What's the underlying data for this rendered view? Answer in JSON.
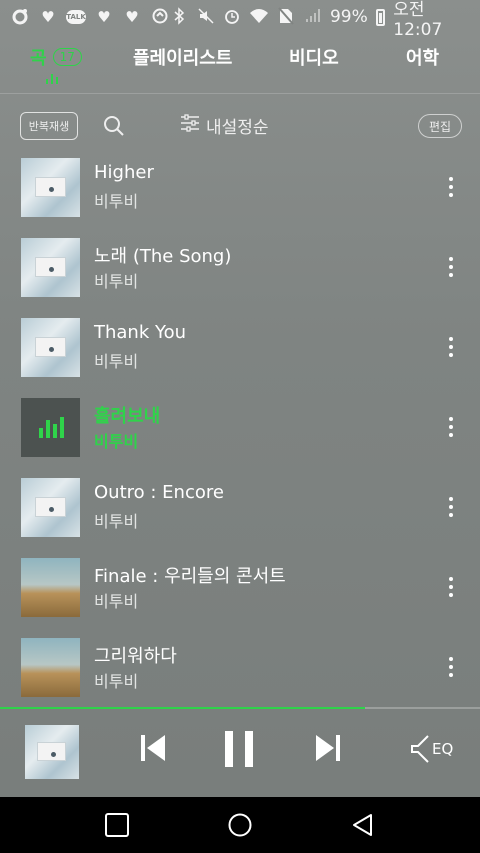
{
  "status_bar": {
    "left_icons": [
      "loop-icon",
      "heart-icon",
      "talk-icon",
      "heart-icon",
      "heart-icon",
      "sync-icon"
    ],
    "talk_label": "TALK",
    "battery": "99%",
    "time": "오전 12:07"
  },
  "tabs": {
    "songs": {
      "label": "곡",
      "count": "17"
    },
    "playlists": {
      "label": "플레이리스트"
    },
    "videos": {
      "label": "비디오"
    },
    "language": {
      "label": "어학"
    }
  },
  "toolbar": {
    "repeat_label": "반복재생",
    "sort_label": "내설정순",
    "edit_label": "편집"
  },
  "songs": [
    {
      "title": "Higher",
      "artist": "비투비",
      "art": "envelope",
      "active": false
    },
    {
      "title": "노래 (The Song)",
      "artist": "비투비",
      "art": "envelope",
      "active": false
    },
    {
      "title": "Thank You",
      "artist": "비투비",
      "art": "envelope",
      "active": false
    },
    {
      "title": "흘려보내",
      "artist": "비투비",
      "art": "playing",
      "active": true
    },
    {
      "title": "Outro : Encore",
      "artist": "비투비",
      "art": "envelope",
      "active": false
    },
    {
      "title": "Finale : 우리들의 콘서트",
      "artist": "비투비",
      "art": "field",
      "active": false
    },
    {
      "title": "그리워하다",
      "artist": "비투비",
      "art": "field",
      "active": false
    }
  ],
  "player": {
    "progress": 0.76,
    "eq_label": "EQ",
    "accent": "#2fd34a"
  }
}
